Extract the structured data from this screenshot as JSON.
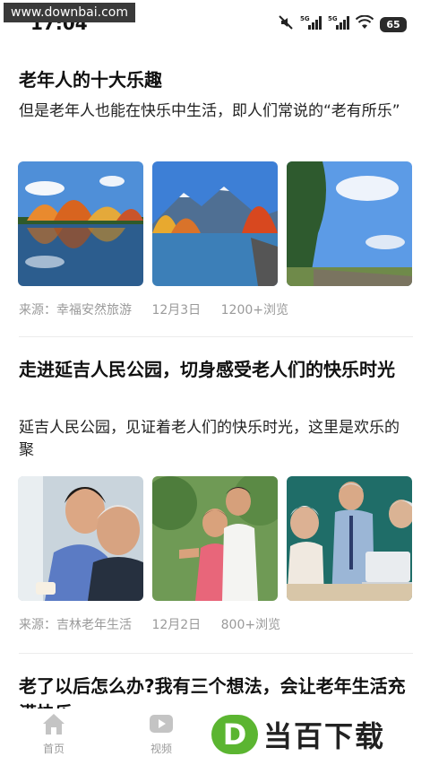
{
  "status_bar": {
    "time": "17:04",
    "battery": "65",
    "watermark": "www.downbai.com"
  },
  "articles": [
    {
      "title": "老年人的十大乐趣",
      "summary": "但是老年人也能在快乐中生活，即人们常说的“老有所乐”",
      "source": "来源：幸福安然旅游",
      "date": "12月3日",
      "views": "1200+浏览",
      "images": [
        "autumn-lake-reflection-photo",
        "mountain-lake-autumn-photo",
        "park-trees-sky-photo"
      ]
    },
    {
      "title": "走进延吉人民公园，切身感受老人们的快乐时光",
      "summary": "延吉人民公园，见证着老人们的快乐时光，这里是欢乐的聚",
      "source": "来源：吉林老年生活",
      "date": "12月2日",
      "views": "800+浏览",
      "images": [
        "elderly-couple-smiling-photo",
        "elderly-couple-outdoors-photo",
        "elderly-laptop-class-photo"
      ]
    },
    {
      "title": "老了以后怎么办?我有三个想法，会让老年生活充满快乐"
    }
  ],
  "tab_bar": {
    "items": [
      {
        "label": "首页",
        "icon": "home-icon"
      },
      {
        "label": "视频",
        "icon": "video-icon"
      }
    ]
  },
  "brand_watermark": {
    "logo_letter": "D",
    "text": "当百下载"
  }
}
